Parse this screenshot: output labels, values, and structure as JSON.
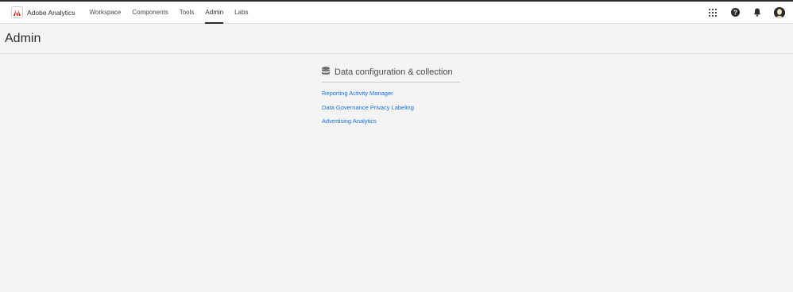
{
  "app": {
    "name": "Adobe Analytics",
    "logo_icon": "adobe-logo-icon",
    "brand_color": "#eb1000"
  },
  "nav": {
    "items": [
      {
        "label": "Workspace",
        "active": false
      },
      {
        "label": "Components",
        "active": false
      },
      {
        "label": "Tools",
        "active": false
      },
      {
        "label": "Admin",
        "active": true
      },
      {
        "label": "Labs",
        "active": false
      }
    ]
  },
  "header_icons": [
    "apps-grid-icon",
    "help-icon",
    "bell-icon",
    "user-avatar-icon"
  ],
  "page": {
    "title": "Admin"
  },
  "section": {
    "icon": "database-icon",
    "title": "Data configuration & collection",
    "links": [
      {
        "label": "Reporting Activity Manager"
      },
      {
        "label": "Data Governance Privacy Labeling"
      },
      {
        "label": "Advertising Analytics"
      }
    ]
  },
  "colors": {
    "link": "#1473e6",
    "background": "#f4f4f4",
    "topbar": "#ffffff"
  }
}
